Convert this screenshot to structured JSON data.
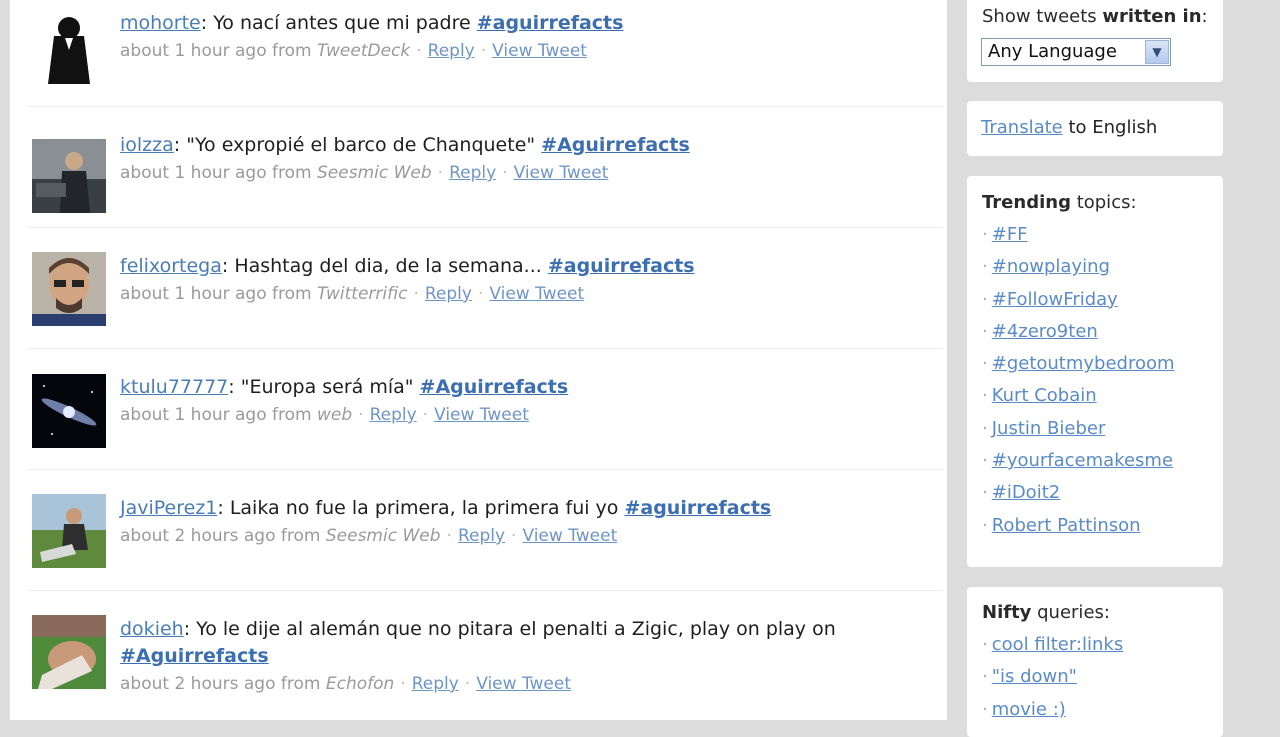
{
  "tweets": [
    {
      "user": "mohorte",
      "text": ": Yo nací antes que mi padre ",
      "tag": "#aguirrefacts",
      "time": "about 1 hour ago from ",
      "source": "TweetDeck",
      "reply": "Reply",
      "view": "View Tweet"
    },
    {
      "user": "iolzza",
      "text": ": \"Yo expropié el barco de Chanquete\" ",
      "tag": "#Aguirrefacts",
      "time": "about 1 hour ago from ",
      "source": "Seesmic Web",
      "reply": "Reply",
      "view": "View Tweet"
    },
    {
      "user": "felixortega",
      "text": ": Hashtag del dia, de la semana... ",
      "tag": "#aguirrefacts",
      "time": "about 1 hour ago from ",
      "source": "Twitterrific",
      "reply": "Reply",
      "view": "View Tweet"
    },
    {
      "user": "ktulu77777",
      "text": ": \"Europa será mía\" ",
      "tag": "#Aguirrefacts",
      "time": "about 1 hour ago from ",
      "source": "web",
      "reply": "Reply",
      "view": "View Tweet"
    },
    {
      "user": "JaviPerez1",
      "text": ": Laika no fue la primera, la primera fui yo ",
      "tag": "#aguirrefacts",
      "time": "about 2 hours ago from ",
      "source": "Seesmic Web",
      "reply": "Reply",
      "view": "View Tweet"
    },
    {
      "user": "dokieh",
      "text": ": Yo le dije al alemán que no pitara el penalti a Zigic, play on play on ",
      "tag": "#Aguirrefacts",
      "time": "about 2 hours ago from ",
      "source": "Echofon",
      "reply": "Reply",
      "view": "View Tweet"
    }
  ],
  "sidebar": {
    "language": {
      "label_pre": "Show tweets ",
      "label_bold": "written in",
      "label_post": ":",
      "selected": "Any Language"
    },
    "translate": {
      "link": "Translate",
      "suffix": " to English"
    },
    "trending": {
      "title_bold": "Trending",
      "title_rest": " topics:",
      "items": [
        "#FF",
        "#nowplaying",
        "#FollowFriday",
        "#4zero9ten",
        "#getoutmybedroom",
        "Kurt Cobain",
        "Justin Bieber",
        "#yourfacemakesme",
        "#iDoit2",
        "Robert Pattinson"
      ]
    },
    "nifty": {
      "title_bold": "Nifty",
      "title_rest": " queries:",
      "items": [
        "cool filter:links",
        "\"is down\"",
        "movie :)"
      ]
    }
  },
  "colors": {
    "link": "#4a7db5",
    "hashtag": "#3d6fb0",
    "meta": "#9a9a9a",
    "background": "#dcdcdc"
  }
}
